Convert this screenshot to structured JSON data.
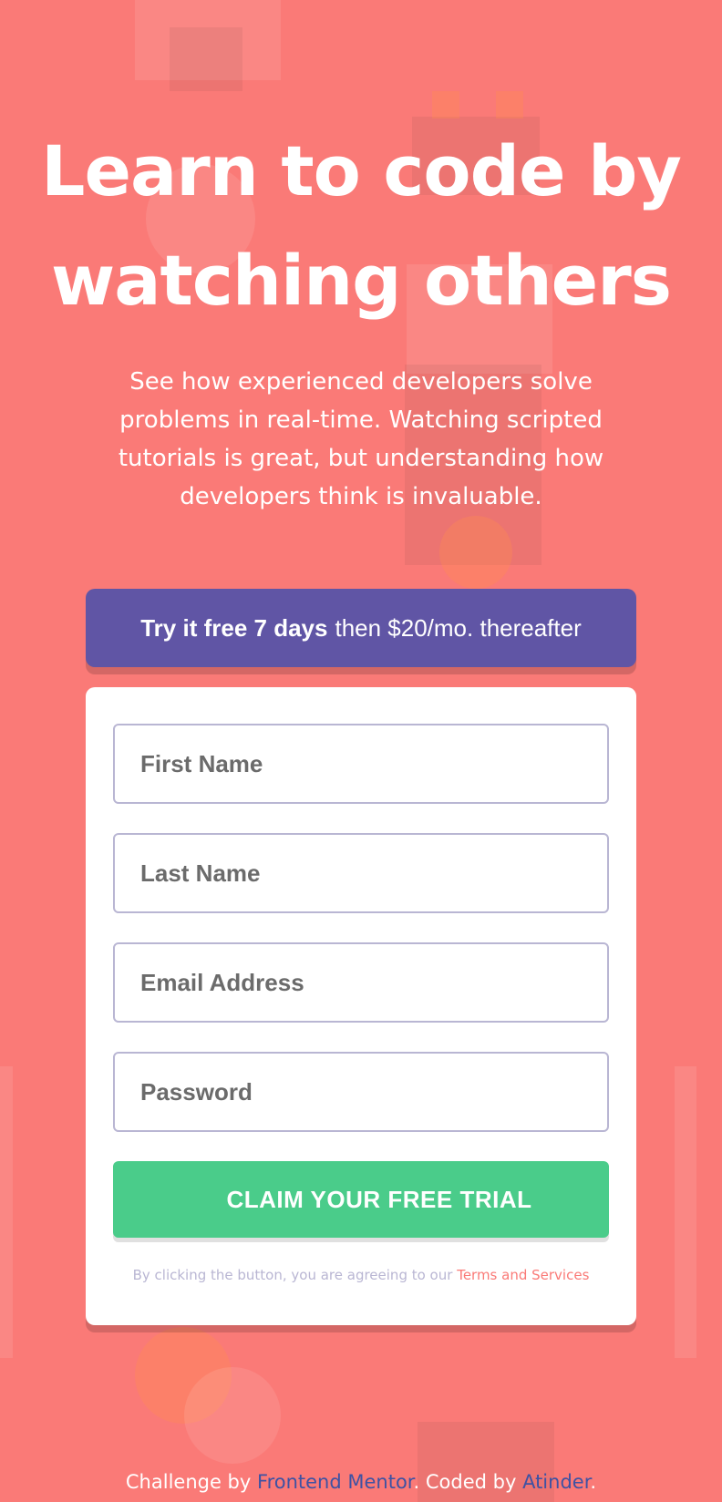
{
  "hero": {
    "title": "Learn to code by watching others",
    "description": "See how experienced developers solve problems in real-time. Watching scripted tutorials is great, but understanding how developers think is invaluable."
  },
  "offer": {
    "bold": "Try it free 7 days",
    "rest": "then $20/mo. thereafter"
  },
  "form": {
    "first_name_placeholder": "First Name",
    "last_name_placeholder": "Last Name",
    "email_placeholder": "Email Address",
    "password_placeholder": "Password",
    "submit_label": "CLAIM YOUR FREE TRIAL",
    "terms_prefix": "By clicking the button, you are agreeing to our",
    "terms_link": "Terms and Services"
  },
  "footer": {
    "prefix": "Challenge by",
    "challenge_link": "Frontend Mentor",
    "middle": ". Coded by",
    "author_link": "Atinder",
    "suffix": "."
  },
  "colors": {
    "background": "#fa7a77",
    "banner": "#6055a5",
    "button": "#4acc8a",
    "link_footer": "#3e52a3",
    "terms_link": "#fa7a77"
  }
}
